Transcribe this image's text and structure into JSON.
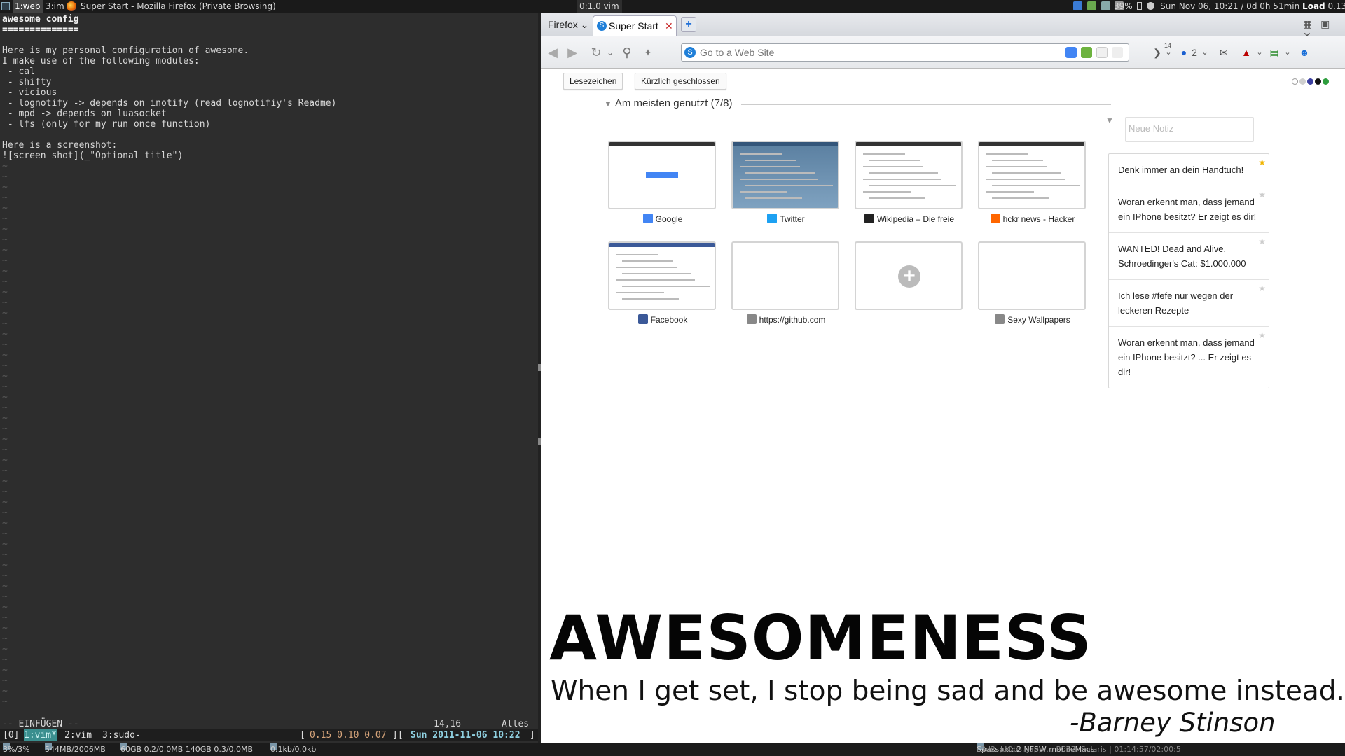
{
  "topbar": {
    "tags": [
      "1:web",
      "3:im"
    ],
    "window_title": "Super Start - Mozilla Firefox (Private Browsing)",
    "vim_title": "0:1.0 vim",
    "battery": "39%",
    "datetime": "Sun Nov 06, 10:21 / 0d 0h 51min",
    "load_label": "Load",
    "load_value": "0.13"
  },
  "vim": {
    "lines": [
      "awesome config",
      "==============",
      "",
      "Here is my personal configuration of awesome.",
      "I make use of the following modules:",
      " - cal",
      " - shifty",
      " - vicious",
      " - lognotify -> depends on inotify (read lognotifiy's Readme)",
      " - mpd -> depends on luasocket",
      " - lfs (only for my run once function)",
      "",
      "Here is a screenshot:",
      "![screen shot](_\"Optional title\")"
    ],
    "mode": "-- EINFÜGEN --",
    "cursor_pos": "14,16",
    "range": "Alles",
    "tmux": {
      "session": "[0]",
      "window_active": "1:vim*",
      "window_2": "2:vim",
      "window_3": "3:sudo-",
      "load_open": "[",
      "load": "0.15 0.10 0.07",
      "sep": "][",
      "date": "Sun 2011-11-06 10:22",
      "close": "]"
    }
  },
  "firefox": {
    "menu_label": "Firefox",
    "tab_title": "Super Start",
    "tab_close": "✕",
    "new_tab": "+",
    "url_placeholder": "Go to a Web Site",
    "ext_badge": "14",
    "ext_count": "2",
    "buttons": {
      "bookmarks": "Lesezeichen",
      "recently_closed": "Kürzlich geschlossen"
    },
    "sites_header": "Am meisten genutzt (7/8)",
    "sites": [
      {
        "label": "Google",
        "fav_color": "#4285f4"
      },
      {
        "label": "Twitter",
        "fav_color": "#1da1f2"
      },
      {
        "label": "Wikipedia – Die freie",
        "fav_color": "#222222"
      },
      {
        "label": "hckr news - Hacker",
        "fav_color": "#ff6600"
      },
      {
        "label": "Facebook",
        "fav_color": "#3b5998"
      },
      {
        "label": "https://github.com",
        "fav_color": "#888888"
      },
      {
        "label": "",
        "fav_color": ""
      },
      {
        "label": "Sexy Wallpapers",
        "fav_color": "#888888"
      }
    ],
    "note_placeholder": "Neue Notiz",
    "notes": [
      {
        "text": "Denk immer an dein Handtuch!",
        "starred": true
      },
      {
        "text": "Woran erkennt man, dass jemand ein IPhone besitzt? Er zeigt es dir!",
        "starred": false
      },
      {
        "text": "WANTED! Dead and Alive. Schroedinger's Cat: $1.000.000",
        "starred": false
      },
      {
        "text": "Ich lese #fefe nur wegen der leckeren Rezepte",
        "starred": false
      },
      {
        "text": "Woran erkennt man, dass jemand ein IPhone besitzt? ... Er zeigt es dir!",
        "starred": false
      }
    ],
    "theme_dots": [
      "#ffffff",
      "#cfcfcf",
      "#3b3fa0",
      "#111111",
      "#2e9e3e"
    ]
  },
  "wallpaper": {
    "title": "AWESOMENESS",
    "quote": "When I get set, I stop being sad and be awesome instead.",
    "author": "-Barney Stinson"
  },
  "bottombar": {
    "cpu": "3%/3%",
    "mem": "544MB/2006MB",
    "disk": "60GB 0.2/0.0MB 140GB 0.3/0.0MB",
    "net": "0.1kb/0.0kb",
    "mpd": "Spasspkt: 2 NFSW mobileMacs",
    "extra": "c3d2, klObs, jupp...: PC37, Solaris | 01:14:57/02:00:5"
  }
}
